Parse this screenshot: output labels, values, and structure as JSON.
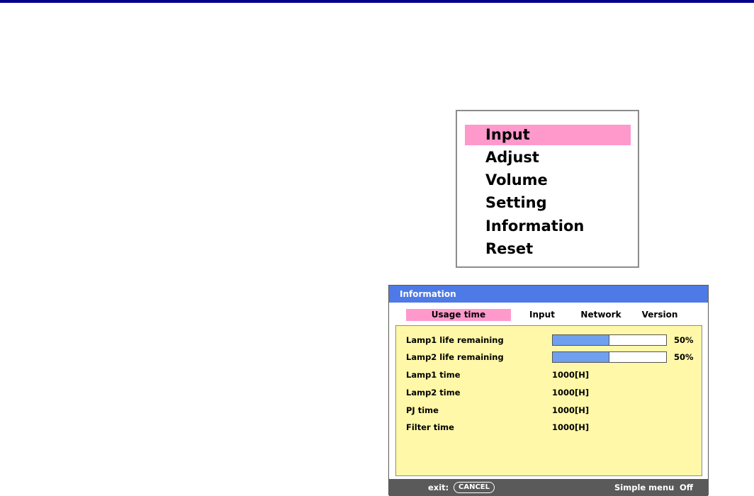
{
  "main_menu": {
    "items": [
      {
        "label": "Input",
        "selected": true
      },
      {
        "label": "Adjust",
        "selected": false
      },
      {
        "label": "Volume",
        "selected": false
      },
      {
        "label": "Setting",
        "selected": false
      },
      {
        "label": "Information",
        "selected": false
      },
      {
        "label": "Reset",
        "selected": false
      }
    ]
  },
  "info_window": {
    "title": "Information",
    "tabs": [
      {
        "label": "Usage time",
        "active": true
      },
      {
        "label": "Input",
        "active": false
      },
      {
        "label": "Network",
        "active": false
      },
      {
        "label": "Version",
        "active": false
      }
    ],
    "rows": {
      "lamp1_life": {
        "label": "Lamp1 life remaining",
        "percent_text": "50%",
        "fraction": 0.5
      },
      "lamp2_life": {
        "label": "Lamp2 life remaining",
        "percent_text": "50%",
        "fraction": 0.5
      },
      "lamp1_time": {
        "label": "Lamp1 time",
        "value": "1000[H]"
      },
      "lamp2_time": {
        "label": "Lamp2 time",
        "value": "1000[H]"
      },
      "pj_time": {
        "label": "PJ time",
        "value": "1000[H]"
      },
      "filter_time": {
        "label": "Filter time",
        "value": "1000[H]"
      }
    },
    "footer": {
      "exit_label": "exit:",
      "cancel_label": "CANCEL",
      "simple_menu_label": "Simple menu",
      "simple_menu_value": "Off"
    }
  },
  "colors": {
    "top_rule": "#00008b",
    "selection": "#ff99cc",
    "title_bar": "#4d7ae6",
    "panel_bg": "#fff8a8",
    "bar_fill": "#6fa0ef",
    "footer_bg": "#5a5a5a"
  }
}
